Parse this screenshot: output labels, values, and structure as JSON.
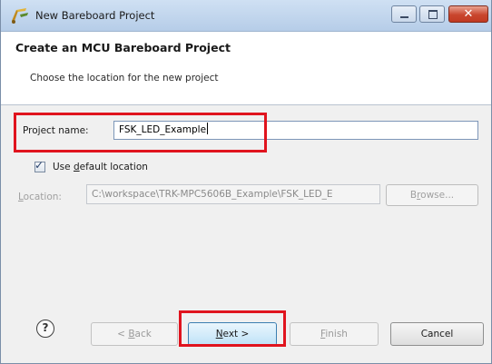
{
  "window": {
    "title": "New Bareboard Project",
    "icon": "new-project-wizard-icon"
  },
  "banner": {
    "title": "Create an MCU Bareboard Project",
    "description": "Choose the location for the new project"
  },
  "project_name": {
    "label": "Project name:",
    "value": "FSK_LED_Example"
  },
  "use_default_location": {
    "label": "Use default location",
    "checked": true
  },
  "location": {
    "label": "Location:",
    "value": "C:\\workspace\\TRK-MPC5606B_Example\\FSK_LED_E",
    "enabled": false
  },
  "buttons": {
    "browse": "Browse...",
    "help": "?",
    "back": "< Back",
    "next": "Next >",
    "finish": "Finish",
    "cancel": "Cancel"
  },
  "colors": {
    "highlight": "#e0141e",
    "titlebar": "#b6cde8",
    "next_button": "#bfe2f7"
  }
}
